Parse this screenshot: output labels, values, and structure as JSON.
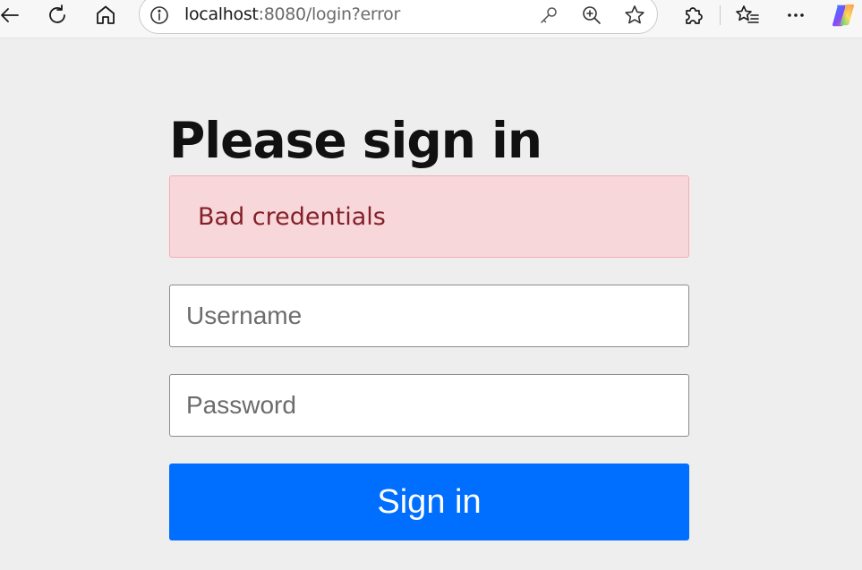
{
  "browser": {
    "url_host": "localhost",
    "url_rest": ":8080/login?error",
    "icons": [
      "back-icon",
      "refresh-icon",
      "home-icon",
      "site-info-icon",
      "key-icon",
      "zoom-icon",
      "favorite-star-icon",
      "extensions-icon",
      "favorites-list-icon",
      "more-icon",
      "copilot-icon"
    ]
  },
  "page": {
    "title": "Please sign in",
    "alert": "Bad credentials",
    "username_placeholder": "Username",
    "password_placeholder": "Password",
    "submit_label": "Sign in"
  },
  "colors": {
    "page_background": "#eeeeee",
    "alert_background": "#f8d7da",
    "alert_text": "#842029",
    "button_background": "#006efe",
    "button_text": "#ffffff"
  }
}
